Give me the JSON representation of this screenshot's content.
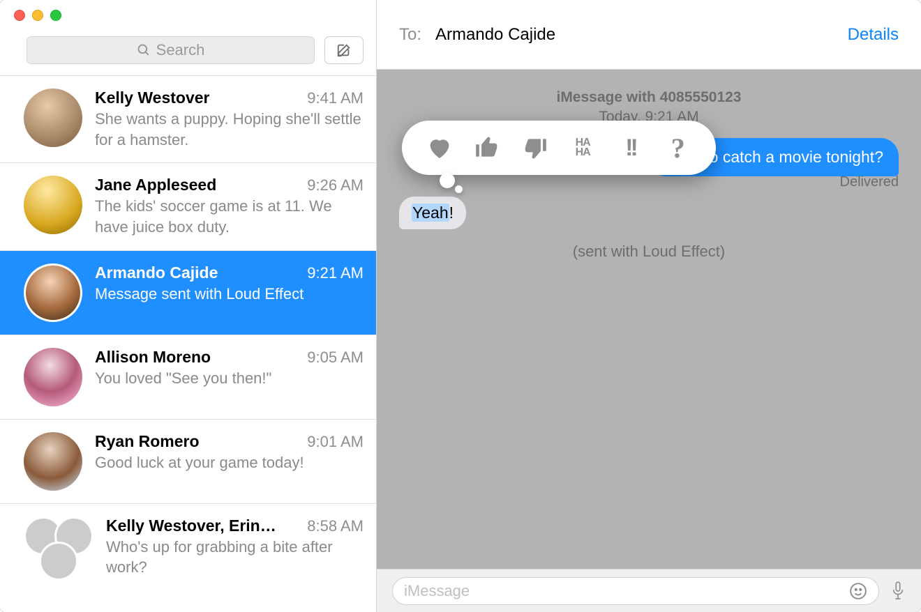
{
  "sidebar": {
    "search_placeholder": "Search",
    "conversations": [
      {
        "name": "Kelly Westover",
        "time": "9:41 AM",
        "preview": "She wants a puppy. Hoping she'll settle for a hamster."
      },
      {
        "name": "Jane Appleseed",
        "time": "9:26 AM",
        "preview": "The kids' soccer game is at 11. We have juice box duty."
      },
      {
        "name": "Armando Cajide",
        "time": "9:21 AM",
        "preview": "Message sent with Loud Effect"
      },
      {
        "name": "Allison Moreno",
        "time": "9:05 AM",
        "preview": "You loved \"See you then!\""
      },
      {
        "name": "Ryan Romero",
        "time": "9:01 AM",
        "preview": "Good luck at your game today!"
      },
      {
        "name": "Kelly Westover, Erin…",
        "time": "8:58 AM",
        "preview": "Who's up for grabbing a bite after work?"
      }
    ]
  },
  "header": {
    "to_label": "To:",
    "to_name": "Armando Cajide",
    "details": "Details"
  },
  "thread": {
    "info_line_1": "iMessage with 4085550123",
    "info_line_2": "Today, 9:21 AM",
    "outgoing_text": "Want to catch a movie tonight?",
    "delivered": "Delivered",
    "incoming_hl": "Yeah",
    "incoming_tail": "!",
    "effect_line": "(sent with Loud Effect)"
  },
  "tapback": {
    "icons": [
      "heart-icon",
      "thumbs-up-icon",
      "thumbs-down-icon",
      "haha-icon",
      "double-exclaim-icon",
      "question-icon"
    ],
    "haha_top": "HA",
    "haha_bottom": "HA",
    "bang": "!!",
    "question": "?"
  },
  "compose": {
    "placeholder": "iMessage"
  }
}
